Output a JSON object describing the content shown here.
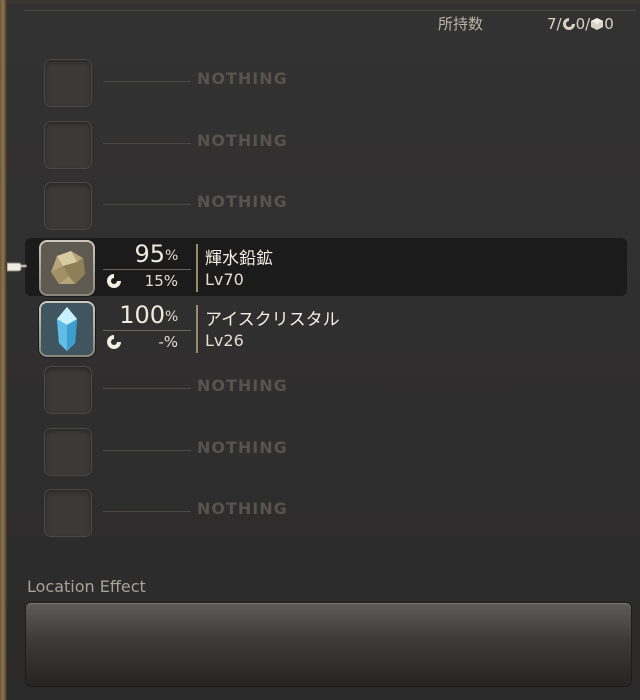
{
  "header": {
    "label": "所持数",
    "count": "7/",
    "crystal_count": "0/",
    "box_count": "0"
  },
  "slots": [
    {
      "type": "empty",
      "text": "NOTHING"
    },
    {
      "type": "empty",
      "text": "NOTHING"
    },
    {
      "type": "empty",
      "text": "NOTHING"
    },
    {
      "type": "item",
      "name": "輝水鉛鉱",
      "level": "Lv70",
      "rate": "95",
      "rate_unit": "%",
      "hq_rate": "15%",
      "icon": "ore-icon",
      "selected": true
    },
    {
      "type": "item",
      "name": "アイスクリスタル",
      "level": "Lv26",
      "rate": "100",
      "rate_unit": "%",
      "hq_rate": "-%",
      "icon": "ice-crystal-icon",
      "selected": false
    },
    {
      "type": "empty",
      "text": "NOTHING"
    },
    {
      "type": "empty",
      "text": "NOTHING"
    },
    {
      "type": "empty",
      "text": "NOTHING"
    }
  ],
  "location_effect": {
    "label": "Location Effect",
    "value": ""
  },
  "colors": {
    "panel": "#2f2e2e",
    "highlight": "#1c1b1b",
    "nothing_text": "#57534d",
    "frame_gold": "#8d7550"
  }
}
